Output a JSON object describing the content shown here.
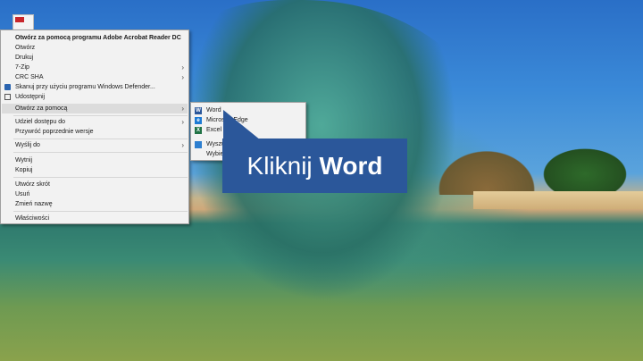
{
  "context_menu": {
    "items": [
      {
        "label": "Otwórz za pomocą programu Adobe Acrobat Reader DC",
        "bold": true
      },
      {
        "label": "Otwórz"
      },
      {
        "label": "Drukuj"
      },
      {
        "label": "7-Zip",
        "submenu": true
      },
      {
        "label": "CRC SHA",
        "submenu": true
      },
      {
        "label": "Skanuj przy użyciu programu Windows Defender...",
        "icon": "defender-icon"
      },
      {
        "label": "Udostępnij",
        "icon": "share-icon"
      },
      {
        "label": "Otwórz za pomocą",
        "submenu": true,
        "highlighted": true
      },
      {
        "label": "Udziel dostępu do",
        "submenu": true
      },
      {
        "label": "Przywróć poprzednie wersje"
      },
      {
        "label": "Wyślij do",
        "submenu": true
      },
      {
        "label": "Wytnij"
      },
      {
        "label": "Kopiuj"
      },
      {
        "label": "Utwórz skrót"
      },
      {
        "label": "Usuń"
      },
      {
        "label": "Zmień nazwę"
      },
      {
        "label": "Właściwości"
      }
    ]
  },
  "open_with_submenu": {
    "items": [
      {
        "label": "Word",
        "icon": "word-icon",
        "color": "#2b579a"
      },
      {
        "label": "Microsoft Edge",
        "icon": "edge-icon",
        "color": "#1e7bd4"
      },
      {
        "label": "Excel",
        "icon": "excel-icon",
        "color": "#217346"
      },
      {
        "label": "Wyszu",
        "icon": "store-icon",
        "color": "#2d7fd0"
      },
      {
        "label": "Wybie"
      }
    ]
  },
  "callout": {
    "text_regular": "Kliknij",
    "text_bold": "Word",
    "color": "#2b579a"
  }
}
